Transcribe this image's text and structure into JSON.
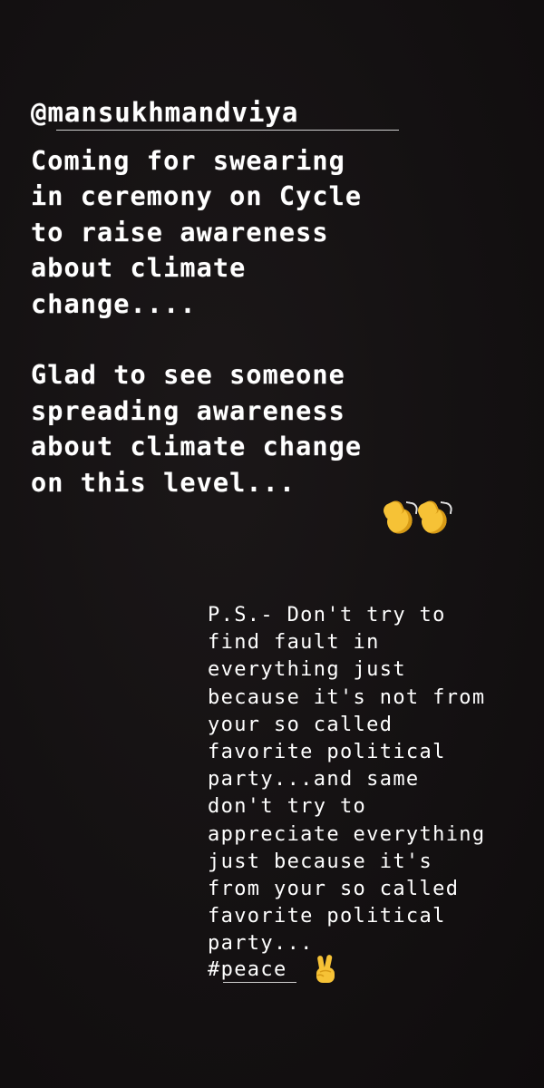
{
  "story": {
    "mention": "@mansukhmandviya",
    "main_text": "Coming for swearing\nin ceremony on Cycle\nto raise awareness\nabout climate\nchange....\n\nGlad to see someone\nspreading awareness\nabout climate change\non this level...",
    "ps_text": "P.S.- Don't try to\nfind fault in\neverything just\nbecause it's not from\nyour so called\nfavorite political\nparty...and same\ndon't try to\nappreciate everything\njust because it's\nfrom your so called\nfavorite political\nparty...",
    "hashtag": "#peace",
    "stickers": [
      "clapping-hands",
      "clapping-hands",
      "victory-hand"
    ],
    "colors": {
      "background": "#131010",
      "text": "#ffffff",
      "emoji_yellow": "#f6c236"
    }
  }
}
